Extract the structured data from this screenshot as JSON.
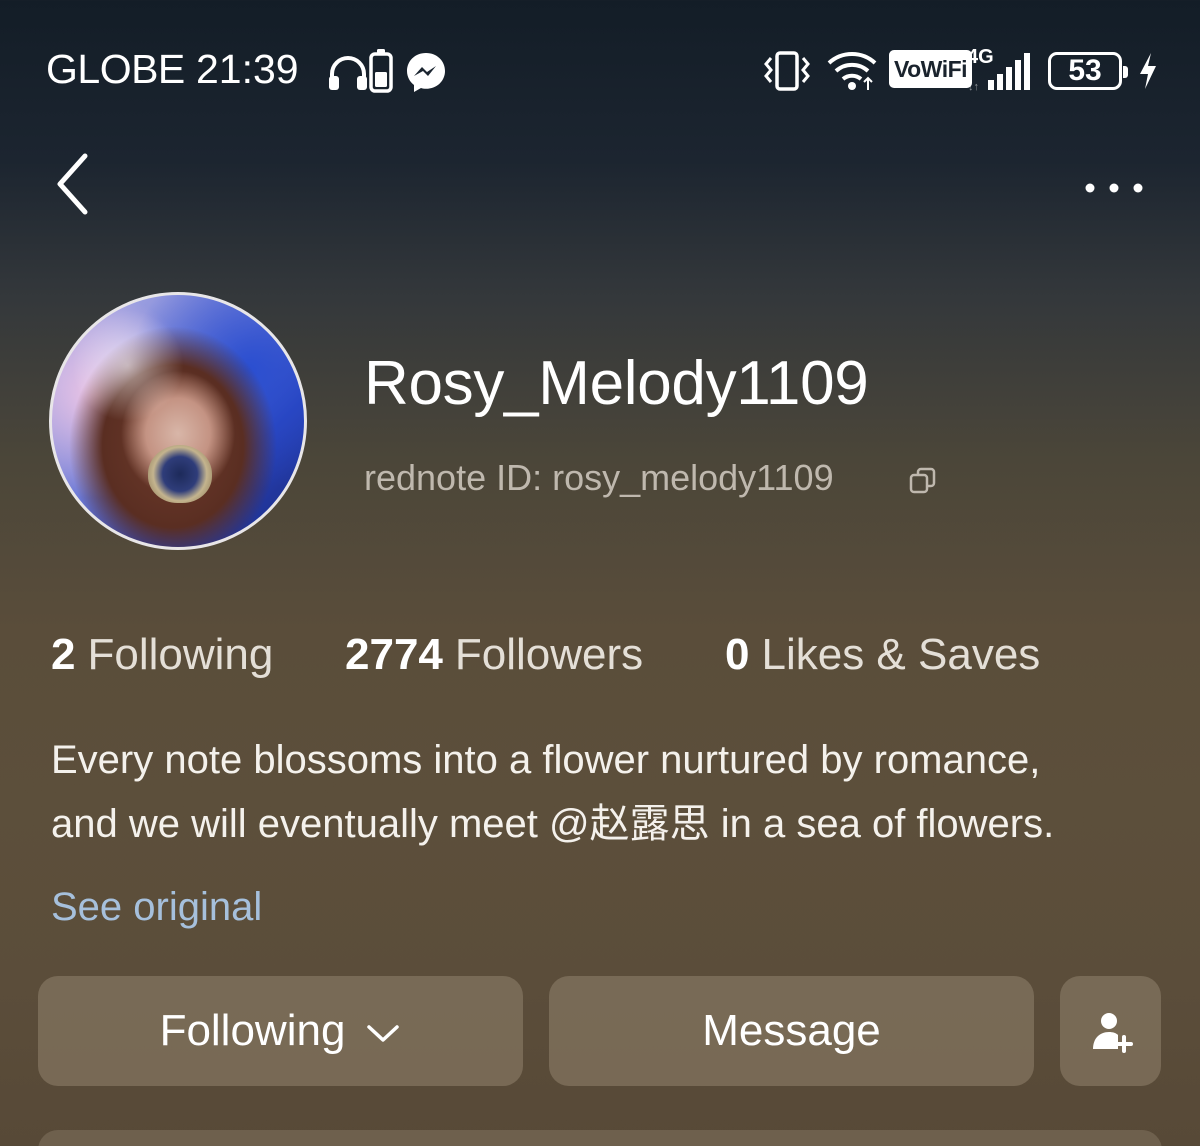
{
  "status_bar": {
    "carrier": "GLOBE",
    "time": "21:39",
    "vowifi": "VoWiFi",
    "network": "4G",
    "battery": "53"
  },
  "icons": {
    "status_left": [
      "headphones-icon",
      "battery-saver-icon",
      "messenger-icon"
    ],
    "status_right": [
      "vibrate-icon",
      "wifi-icon",
      "signal-icon",
      "charging-icon"
    ],
    "nav": [
      "back-icon",
      "more-icon"
    ],
    "profile": [
      "copy-icon"
    ],
    "actions": [
      "chevron-down-icon",
      "add-friend-icon"
    ]
  },
  "profile": {
    "username": "Rosy_Melody1109",
    "rednote_id": "rednote ID: rosy_melody1109"
  },
  "stats": {
    "following_count": "2",
    "following_label": "Following",
    "followers_count": "2774",
    "followers_label": "Followers",
    "likes_count": "0",
    "likes_label": "Likes & Saves"
  },
  "bio": {
    "line1": "Every note blossoms into a flower nurtured by romance,",
    "line2": "and we will eventually meet @赵露思 in a sea of flowers.",
    "see_original": "See original"
  },
  "actions": {
    "following_label": "Following",
    "message_label": "Message"
  },
  "colors": {
    "link": "#a6c0dc",
    "button_bg": "#8b7c68",
    "muted_text": "#bfb8ae"
  }
}
